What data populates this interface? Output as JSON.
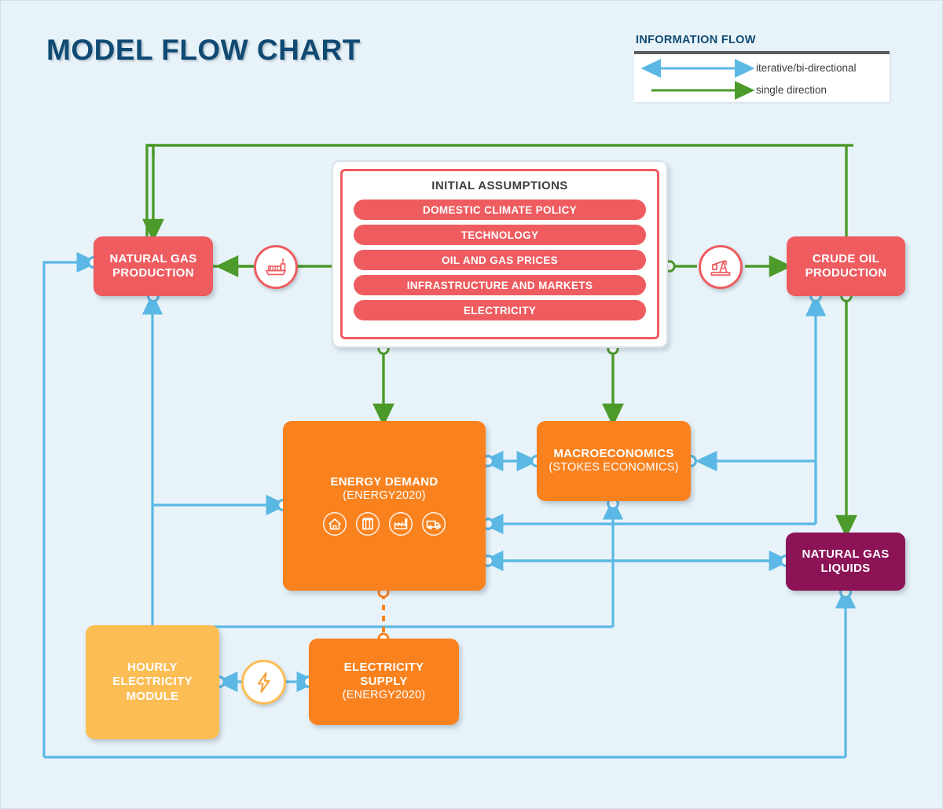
{
  "page": {
    "title": "MODEL FLOW CHART",
    "background_color": "#e8f3f9",
    "title_color": "#104a73"
  },
  "legend": {
    "title": "INFORMATION FLOW",
    "items": [
      {
        "label": "iterative/bi-directional",
        "color": "#5bb8e4",
        "style": "bi-directional-arrow"
      },
      {
        "label": "single direction",
        "color": "#4c9a2a",
        "style": "single-direction-arrow"
      }
    ]
  },
  "assumptions": {
    "heading": "INITIAL ASSUMPTIONS",
    "items": [
      "DOMESTIC CLIMATE POLICY",
      "TECHNOLOGY",
      "OIL AND GAS PRICES",
      "INFRASTRUCTURE AND MARKETS",
      "ELECTRICITY"
    ],
    "pill_color": "#ee5c60",
    "border_color": "#ee5c60"
  },
  "nodes": {
    "natural_gas_production": {
      "line1": "NATURAL GAS",
      "line2": "PRODUCTION",
      "color": "#ee5c60"
    },
    "crude_oil_production": {
      "line1": "CRUDE OIL",
      "line2": "PRODUCTION",
      "color": "#ee5c60"
    },
    "energy_demand": {
      "line1": "ENERGY DEMAND",
      "line2": "(ENERGY2020)",
      "color": "#f9821f"
    },
    "macroeconomics": {
      "line1": "MACROECONOMICS",
      "line2": "(STOKES ECONOMICS)",
      "color": "#f9821f"
    },
    "natural_gas_liquids": {
      "line1": "NATURAL GAS",
      "line2": "LIQUIDS",
      "color": "#8b1356"
    },
    "hourly_electricity_module": {
      "line1": "HOURLY",
      "line2": "ELECTRICITY",
      "line3": "MODULE",
      "color": "#fcbd55"
    },
    "electricity_supply": {
      "line1": "ELECTRICITY",
      "line2": "SUPPLY",
      "line3": "(ENERGY2020)",
      "color": "#f9821f"
    }
  },
  "icons": {
    "ship": "ship-icon",
    "pumpjack": "oil-pumpjack-icon",
    "bolt": "lightning-bolt-icon",
    "sectors": [
      "residential-house-icon",
      "commercial-building-icon",
      "industrial-factory-icon",
      "transportation-truck-icon"
    ]
  },
  "chart_data": {
    "type": "diagram",
    "title": "MODEL FLOW CHART",
    "nodes": [
      {
        "id": "natural_gas_production",
        "label": "NATURAL GAS PRODUCTION",
        "color": "#ee5c60"
      },
      {
        "id": "crude_oil_production",
        "label": "CRUDE OIL PRODUCTION",
        "color": "#ee5c60"
      },
      {
        "id": "initial_assumptions",
        "label": "INITIAL ASSUMPTIONS",
        "color": "#ffffff"
      },
      {
        "id": "energy_demand",
        "label": "ENERGY DEMAND (ENERGY2020)",
        "color": "#f9821f"
      },
      {
        "id": "macroeconomics",
        "label": "MACROECONOMICS (STOKES ECONOMICS)",
        "color": "#f9821f"
      },
      {
        "id": "natural_gas_liquids",
        "label": "NATURAL GAS LIQUIDS",
        "color": "#8b1356"
      },
      {
        "id": "hourly_electricity_module",
        "label": "HOURLY ELECTRICITY MODULE",
        "color": "#fcbd55"
      },
      {
        "id": "electricity_supply",
        "label": "ELECTRICITY SUPPLY (ENERGY2020)",
        "color": "#f9821f"
      }
    ],
    "edges": [
      {
        "from": "initial_assumptions",
        "to": "natural_gas_production",
        "kind": "single direction",
        "color": "#4c9a2a"
      },
      {
        "from": "initial_assumptions",
        "to": "crude_oil_production",
        "kind": "single direction",
        "color": "#4c9a2a"
      },
      {
        "from": "initial_assumptions",
        "to": "energy_demand",
        "kind": "single direction",
        "color": "#4c9a2a"
      },
      {
        "from": "initial_assumptions",
        "to": "macroeconomics",
        "kind": "single direction",
        "color": "#4c9a2a"
      },
      {
        "from": "crude_oil_production",
        "to": "natural_gas_liquids",
        "kind": "single direction",
        "color": "#4c9a2a"
      },
      {
        "from": "energy_demand",
        "to": "macroeconomics",
        "kind": "iterative/bi-directional",
        "color": "#5bb8e4"
      },
      {
        "from": "natural_gas_liquids",
        "to": "macroeconomics",
        "kind": "iterative/bi-directional",
        "color": "#5bb8e4"
      },
      {
        "from": "natural_gas_liquids",
        "to": "energy_demand",
        "kind": "iterative/bi-directional",
        "color": "#5bb8e4"
      },
      {
        "from": "energy_demand",
        "to": "natural_gas_production",
        "kind": "iterative/bi-directional",
        "color": "#5bb8e4"
      },
      {
        "from": "energy_demand",
        "to": "crude_oil_production",
        "kind": "iterative/bi-directional",
        "color": "#5bb8e4"
      },
      {
        "from": "electricity_supply",
        "to": "energy_demand",
        "kind": "dashed link",
        "color": "#f9821f"
      },
      {
        "from": "hourly_electricity_module",
        "to": "electricity_supply",
        "kind": "iterative/bi-directional",
        "color": "#5bb8e4"
      }
    ]
  }
}
